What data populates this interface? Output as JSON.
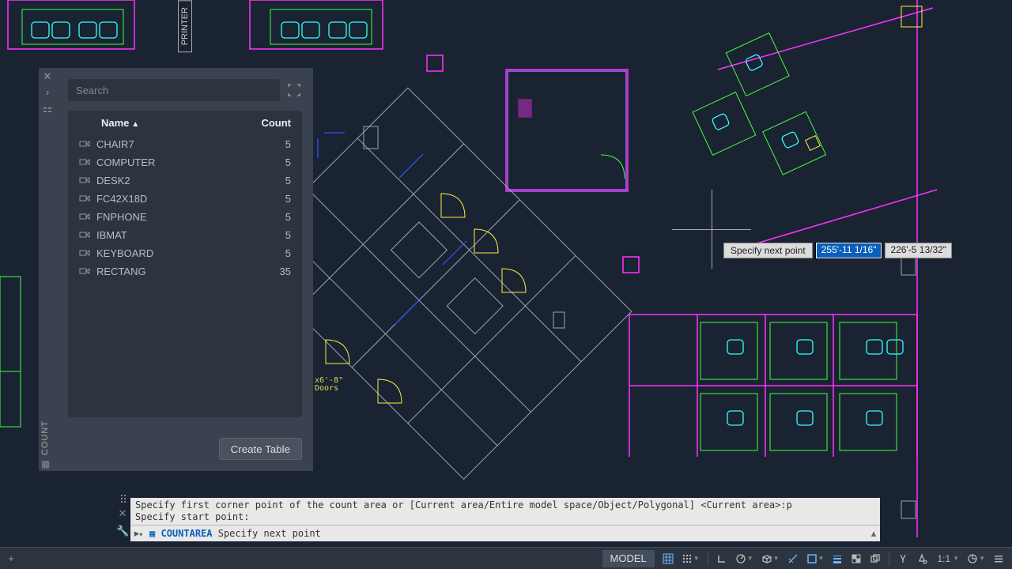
{
  "palette": {
    "title": "COUNT",
    "search_placeholder": "Search",
    "header_name": "Name",
    "header_count": "Count",
    "sort_indicator": "▲",
    "items": [
      {
        "name": "CHAIR7",
        "count": "5"
      },
      {
        "name": "COMPUTER",
        "count": "5"
      },
      {
        "name": "DESK2",
        "count": "5"
      },
      {
        "name": "FC42X18D",
        "count": "5"
      },
      {
        "name": "FNPHONE",
        "count": "5"
      },
      {
        "name": "IBMAT",
        "count": "5"
      },
      {
        "name": "KEYBOARD",
        "count": "5"
      },
      {
        "name": "RECTANG",
        "count": "35"
      }
    ],
    "create_table_label": "Create Table"
  },
  "dyn_input": {
    "prompt": "Specify next point",
    "val1": "255'-11 1/16\"",
    "val2": "226'-5 13/32\""
  },
  "cmdline": {
    "history_line1": "Specify first corner point of the count area or [Current area/Entire model space/Object/Polygonal] <Current area>:p",
    "history_line2": "Specify start point:",
    "command": "COUNTAREA",
    "prompt": "Specify next point"
  },
  "drawing_labels": {
    "printer": "PRINTER",
    "doors_note": "x6'-8\"\nDoors"
  },
  "statusbar": {
    "model_label": "MODEL",
    "scale": "1:1"
  }
}
